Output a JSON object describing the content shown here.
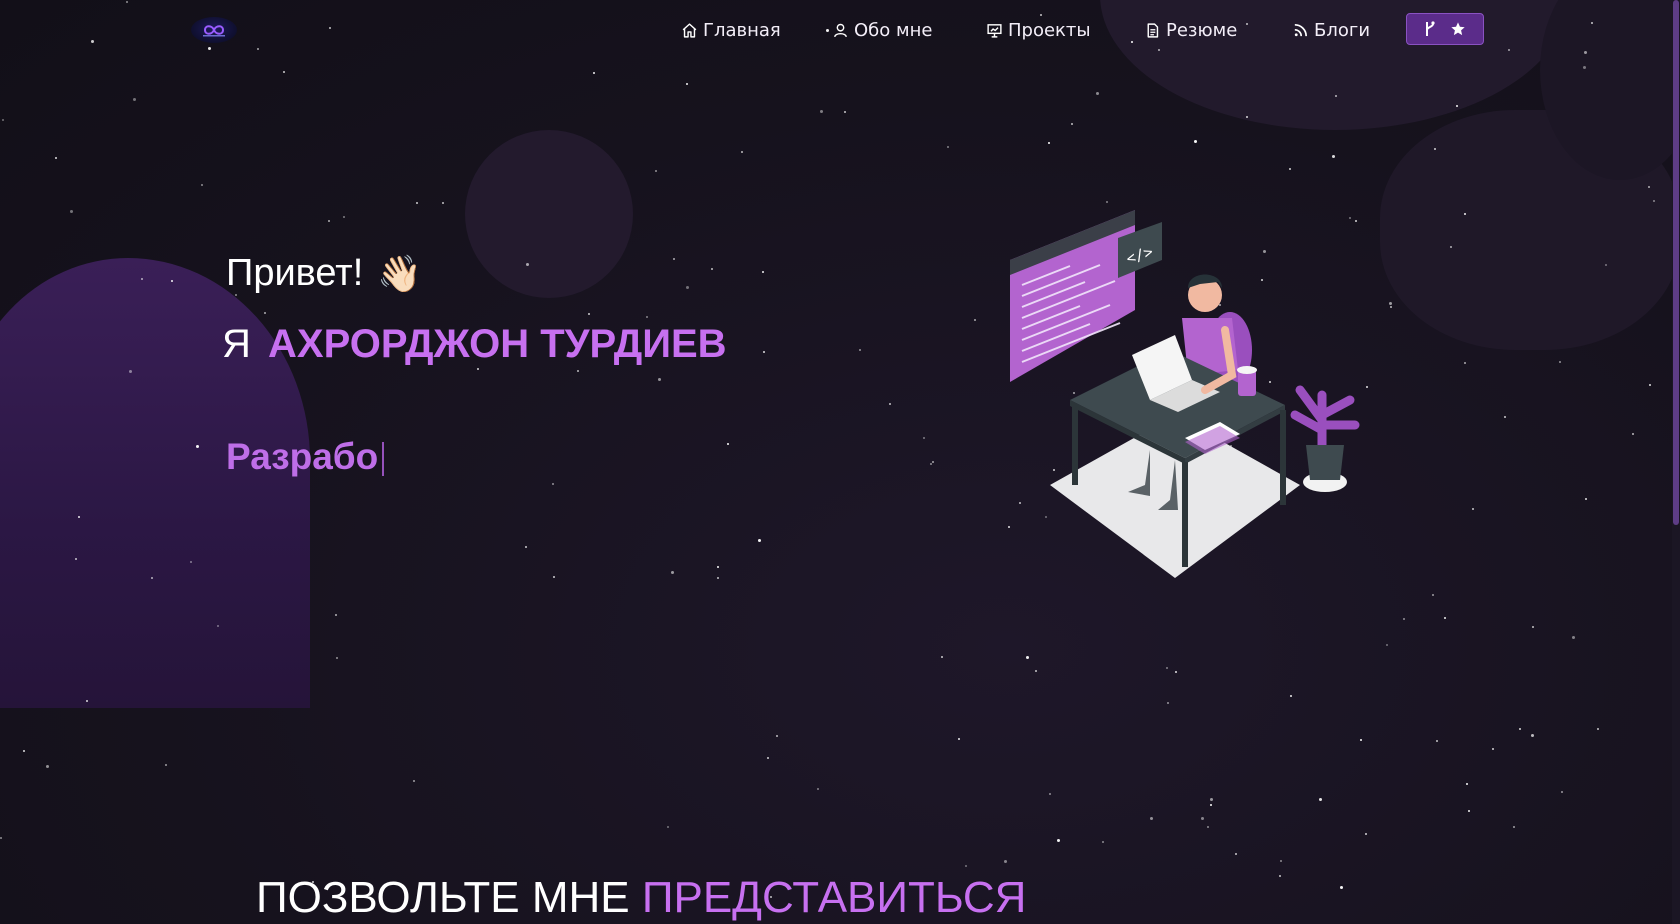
{
  "navbar": {
    "logo_name": "logo",
    "items": [
      {
        "label": "Главная",
        "icon": "home-icon"
      },
      {
        "label": "Обо мне",
        "icon": "user-icon"
      },
      {
        "label": "Проекты",
        "icon": "presentation-icon"
      },
      {
        "label": "Резюме",
        "icon": "document-icon"
      },
      {
        "label": "Блоги",
        "icon": "feed-icon"
      }
    ],
    "github_button": {
      "icons": [
        "git-fork-icon",
        "star-icon"
      ]
    }
  },
  "hero": {
    "greeting": "Привет!",
    "wave_emoji": "👋🏻",
    "name_prefix": "Я",
    "name": "АХРОРДЖОН ТУРДИЕВ",
    "typed_text": "Разрабо"
  },
  "intro": {
    "title_white": "ПОЗВОЛЬТЕ МНЕ",
    "title_accent": "ПРЕДСТАВИТЬСЯ"
  },
  "colors": {
    "background": "#17131f",
    "accent": "#c770f0",
    "button": "#5b2c8a"
  }
}
